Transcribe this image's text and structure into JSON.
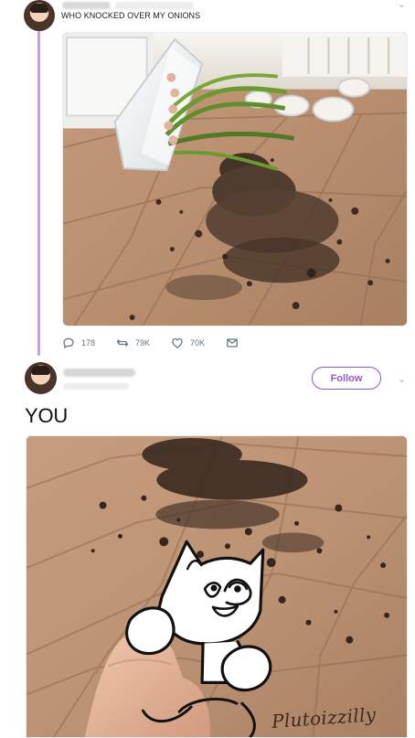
{
  "tweet_1": {
    "text": "WHO KNOCKED OVER MY ONIONS",
    "actions": [
      {
        "name": "reply",
        "count": "178"
      },
      {
        "name": "retweet",
        "count": "79K"
      },
      {
        "name": "like",
        "count": "70K"
      },
      {
        "name": "message",
        "count": ""
      }
    ]
  },
  "tweet_2": {
    "follow_label": "Follow",
    "text": "YOU"
  },
  "art": {
    "signature": "Plutoizzilly"
  },
  "colors": {
    "accent": "#8e57c6",
    "thread_line": "#c7a1e6",
    "muted": "#657786",
    "text": "#14171a",
    "floor": "#b8906f",
    "soil": "#3a2a20"
  }
}
